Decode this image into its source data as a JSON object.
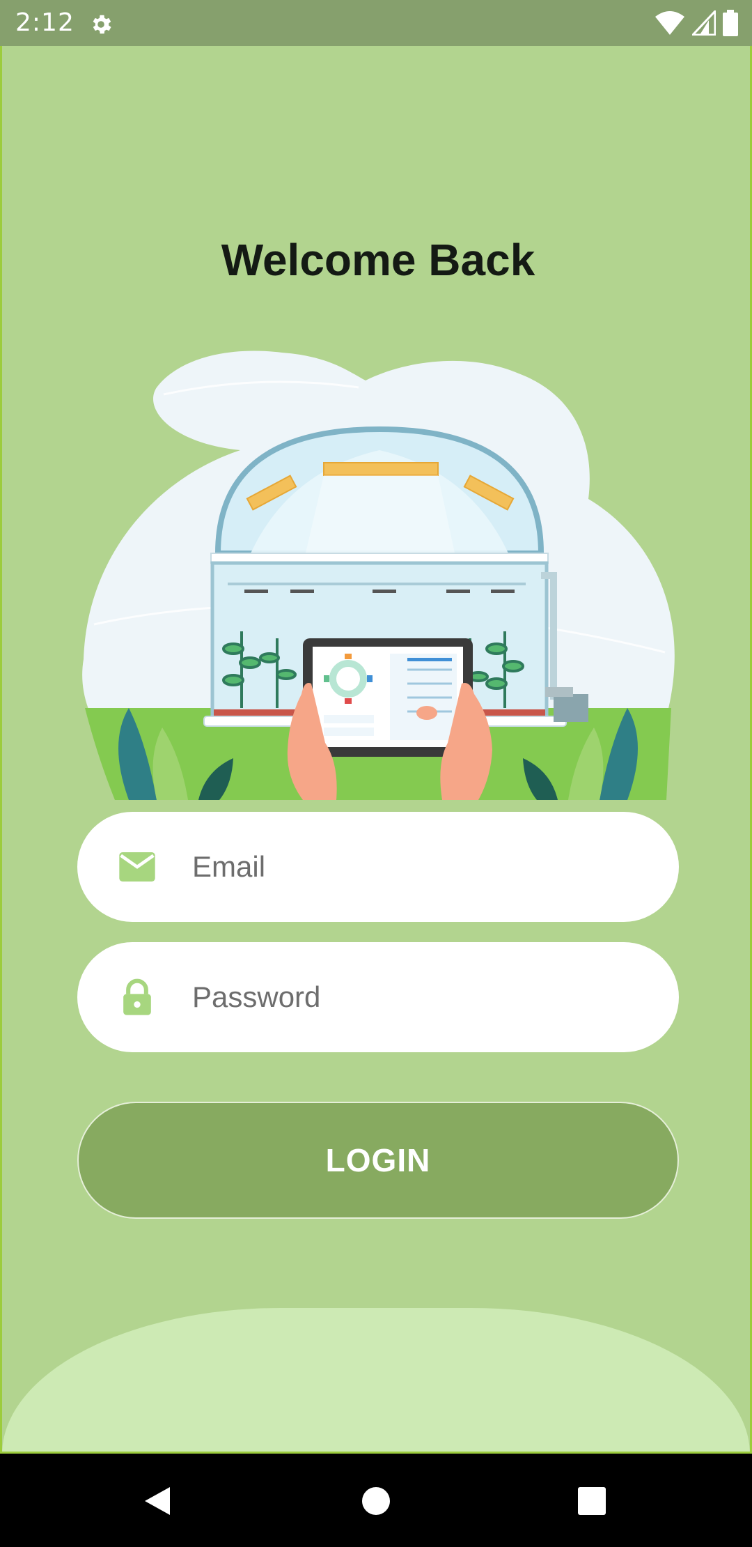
{
  "status_bar": {
    "time": "2:12",
    "icons": [
      "gear-icon",
      "wifi-icon",
      "signal-icon",
      "battery-icon"
    ]
  },
  "login": {
    "title": "Welcome Back",
    "email_placeholder": "Email",
    "password_placeholder": "Password",
    "button_label": "LOGIN"
  },
  "hero": {
    "icon": "greenhouse-tablet-illustration"
  },
  "nav_bar": {
    "icons": [
      "back-icon",
      "home-icon",
      "recents-icon"
    ]
  },
  "colors": {
    "background": "#b2d48f",
    "status_bar": "#86a06d",
    "button": "#87aa60",
    "icon_accent": "#a7d67f",
    "bottom_wave": "#cdeab4"
  }
}
